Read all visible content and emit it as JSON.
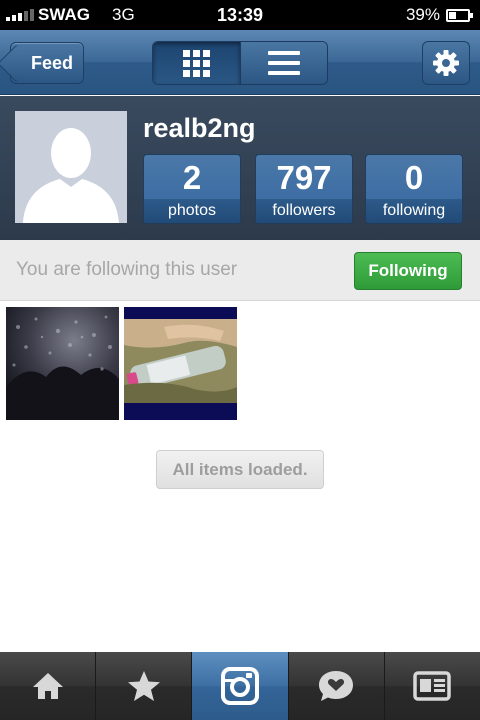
{
  "status_bar": {
    "carrier": "SWAG",
    "network": "3G",
    "time": "13:39",
    "battery_percent": "39%",
    "battery_level": 0.39
  },
  "nav": {
    "back_label": "Feed",
    "view_modes": [
      "grid-icon",
      "list-icon"
    ],
    "active_view": "grid",
    "settings_icon": "gear-icon"
  },
  "profile": {
    "username": "realb2ng",
    "stats": [
      {
        "value": "2",
        "label": "photos"
      },
      {
        "value": "797",
        "label": "followers"
      },
      {
        "value": "0",
        "label": "following"
      }
    ]
  },
  "follow": {
    "status_text": "You are following this user",
    "button_label": "Following",
    "button_color": "#3aad43"
  },
  "photos": [
    {
      "description_icon": "photo-thumbnail"
    },
    {
      "description_icon": "photo-thumbnail"
    }
  ],
  "footer": {
    "loaded_label": "All items loaded."
  },
  "tab_bar": {
    "items": [
      "home-icon",
      "star-icon",
      "camera-icon",
      "heart-bubble-icon",
      "profile-card-icon"
    ],
    "active_index": 2
  },
  "colors": {
    "nav_blue": "#3b6796",
    "profile_dark": "#34435a",
    "stat_blue": "#3d6fa3",
    "tab_active": "#3d6fa3"
  }
}
